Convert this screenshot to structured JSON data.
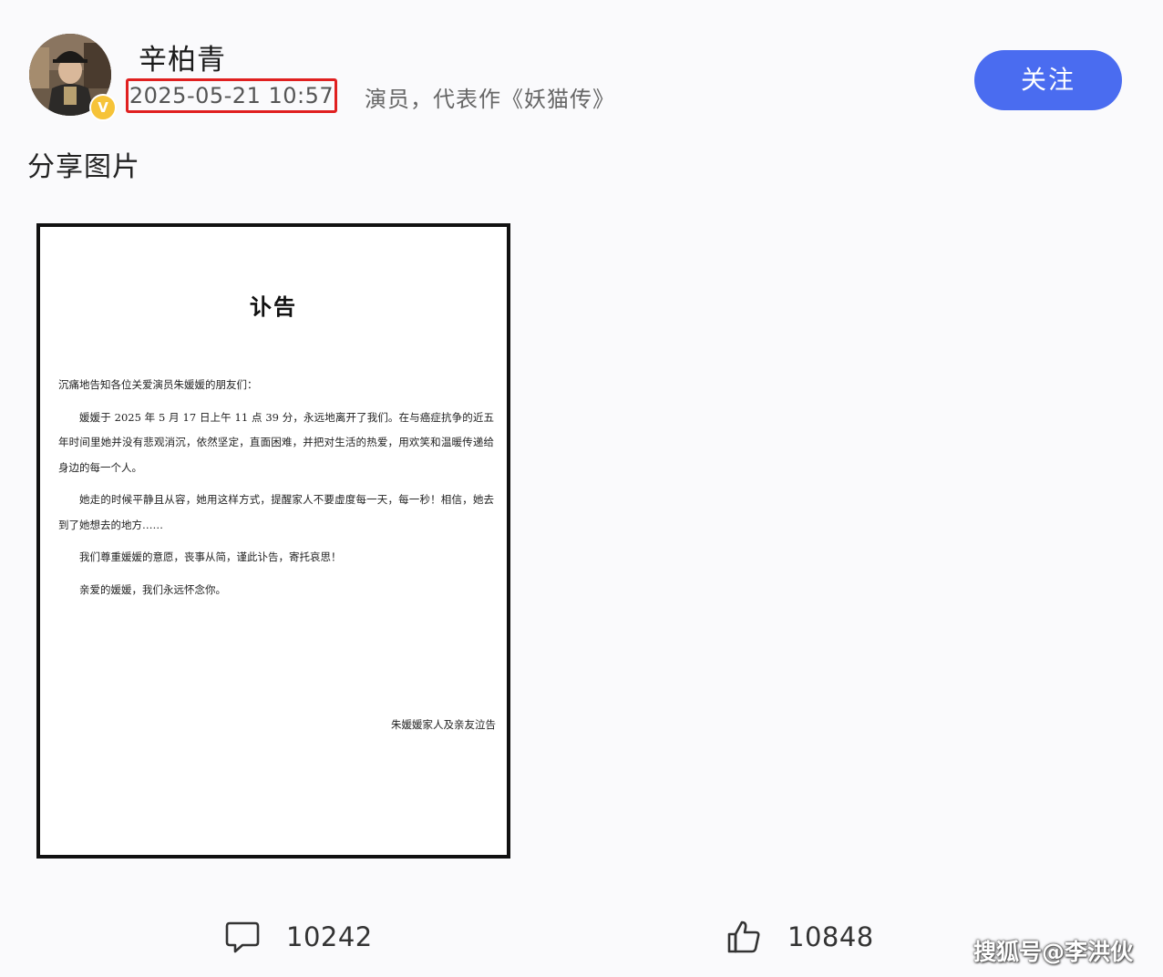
{
  "author": {
    "name": "辛柏青",
    "timestamp": "2025-05-21 10:57",
    "bio": "演员，代表作《妖猫传》",
    "verified_badge": "V"
  },
  "follow_label": "关注",
  "post": {
    "text": "分享图片"
  },
  "notice": {
    "title": "讣告",
    "greeting": "沉痛地告知各位关爱演员朱媛媛的朋友们：",
    "paragraphs": [
      "媛媛于 2025 年 5 月 17 日上午 11 点 39 分，永远地离开了我们。在与癌症抗争的近五年时间里她并没有悲观消沉，依然坚定，直面困难，并把对生活的热爱，用欢笑和温暖传递给身边的每一个人。",
      "她走的时候平静且从容，她用这样方式，提醒家人不要虚度每一天，每一秒！相信，她去到了她想去的地方……",
      "我们尊重媛媛的意愿，丧事从简，谨此讣告，寄托哀思！",
      "亲爱的媛媛，我们永远怀念你。"
    ],
    "signature": "朱媛媛家人及亲友泣告"
  },
  "stats": {
    "comments": "10242",
    "likes": "10848"
  },
  "watermark": "搜狐号@李洪伙",
  "colors": {
    "accent": "#4a6cf0",
    "highlight": "#e02020",
    "badge": "#f6c338"
  }
}
